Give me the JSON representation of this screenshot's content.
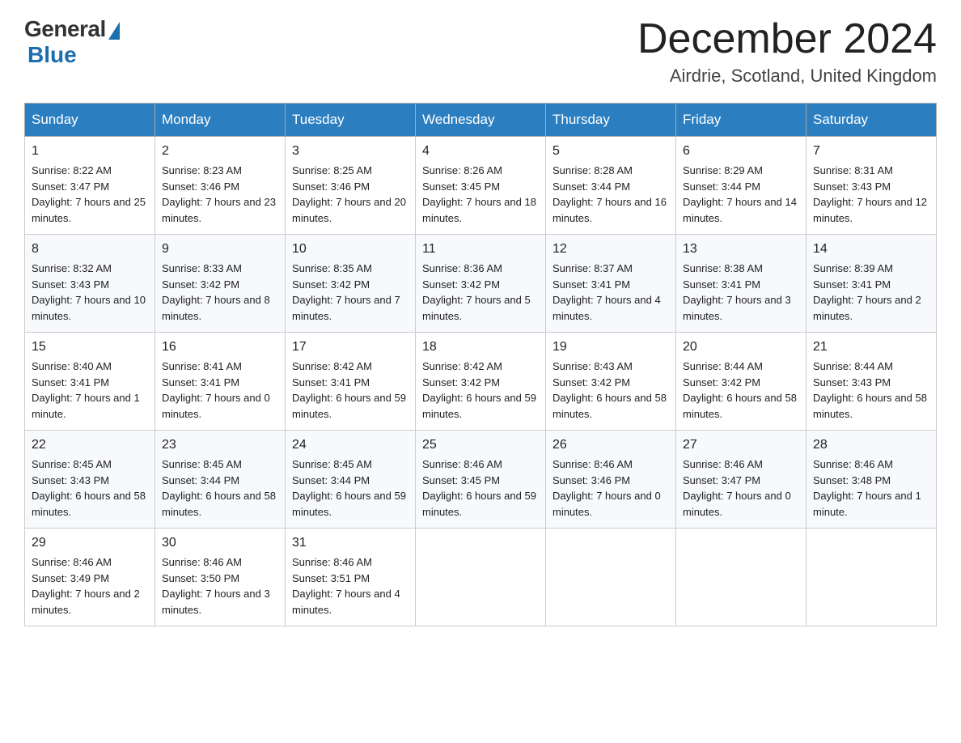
{
  "header": {
    "logo_general": "General",
    "logo_blue": "Blue",
    "month_title": "December 2024",
    "location": "Airdrie, Scotland, United Kingdom"
  },
  "days_of_week": [
    "Sunday",
    "Monday",
    "Tuesday",
    "Wednesday",
    "Thursday",
    "Friday",
    "Saturday"
  ],
  "weeks": [
    [
      {
        "day": "1",
        "sunrise": "Sunrise: 8:22 AM",
        "sunset": "Sunset: 3:47 PM",
        "daylight": "Daylight: 7 hours and 25 minutes."
      },
      {
        "day": "2",
        "sunrise": "Sunrise: 8:23 AM",
        "sunset": "Sunset: 3:46 PM",
        "daylight": "Daylight: 7 hours and 23 minutes."
      },
      {
        "day": "3",
        "sunrise": "Sunrise: 8:25 AM",
        "sunset": "Sunset: 3:46 PM",
        "daylight": "Daylight: 7 hours and 20 minutes."
      },
      {
        "day": "4",
        "sunrise": "Sunrise: 8:26 AM",
        "sunset": "Sunset: 3:45 PM",
        "daylight": "Daylight: 7 hours and 18 minutes."
      },
      {
        "day": "5",
        "sunrise": "Sunrise: 8:28 AM",
        "sunset": "Sunset: 3:44 PM",
        "daylight": "Daylight: 7 hours and 16 minutes."
      },
      {
        "day": "6",
        "sunrise": "Sunrise: 8:29 AM",
        "sunset": "Sunset: 3:44 PM",
        "daylight": "Daylight: 7 hours and 14 minutes."
      },
      {
        "day": "7",
        "sunrise": "Sunrise: 8:31 AM",
        "sunset": "Sunset: 3:43 PM",
        "daylight": "Daylight: 7 hours and 12 minutes."
      }
    ],
    [
      {
        "day": "8",
        "sunrise": "Sunrise: 8:32 AM",
        "sunset": "Sunset: 3:43 PM",
        "daylight": "Daylight: 7 hours and 10 minutes."
      },
      {
        "day": "9",
        "sunrise": "Sunrise: 8:33 AM",
        "sunset": "Sunset: 3:42 PM",
        "daylight": "Daylight: 7 hours and 8 minutes."
      },
      {
        "day": "10",
        "sunrise": "Sunrise: 8:35 AM",
        "sunset": "Sunset: 3:42 PM",
        "daylight": "Daylight: 7 hours and 7 minutes."
      },
      {
        "day": "11",
        "sunrise": "Sunrise: 8:36 AM",
        "sunset": "Sunset: 3:42 PM",
        "daylight": "Daylight: 7 hours and 5 minutes."
      },
      {
        "day": "12",
        "sunrise": "Sunrise: 8:37 AM",
        "sunset": "Sunset: 3:41 PM",
        "daylight": "Daylight: 7 hours and 4 minutes."
      },
      {
        "day": "13",
        "sunrise": "Sunrise: 8:38 AM",
        "sunset": "Sunset: 3:41 PM",
        "daylight": "Daylight: 7 hours and 3 minutes."
      },
      {
        "day": "14",
        "sunrise": "Sunrise: 8:39 AM",
        "sunset": "Sunset: 3:41 PM",
        "daylight": "Daylight: 7 hours and 2 minutes."
      }
    ],
    [
      {
        "day": "15",
        "sunrise": "Sunrise: 8:40 AM",
        "sunset": "Sunset: 3:41 PM",
        "daylight": "Daylight: 7 hours and 1 minute."
      },
      {
        "day": "16",
        "sunrise": "Sunrise: 8:41 AM",
        "sunset": "Sunset: 3:41 PM",
        "daylight": "Daylight: 7 hours and 0 minutes."
      },
      {
        "day": "17",
        "sunrise": "Sunrise: 8:42 AM",
        "sunset": "Sunset: 3:41 PM",
        "daylight": "Daylight: 6 hours and 59 minutes."
      },
      {
        "day": "18",
        "sunrise": "Sunrise: 8:42 AM",
        "sunset": "Sunset: 3:42 PM",
        "daylight": "Daylight: 6 hours and 59 minutes."
      },
      {
        "day": "19",
        "sunrise": "Sunrise: 8:43 AM",
        "sunset": "Sunset: 3:42 PM",
        "daylight": "Daylight: 6 hours and 58 minutes."
      },
      {
        "day": "20",
        "sunrise": "Sunrise: 8:44 AM",
        "sunset": "Sunset: 3:42 PM",
        "daylight": "Daylight: 6 hours and 58 minutes."
      },
      {
        "day": "21",
        "sunrise": "Sunrise: 8:44 AM",
        "sunset": "Sunset: 3:43 PM",
        "daylight": "Daylight: 6 hours and 58 minutes."
      }
    ],
    [
      {
        "day": "22",
        "sunrise": "Sunrise: 8:45 AM",
        "sunset": "Sunset: 3:43 PM",
        "daylight": "Daylight: 6 hours and 58 minutes."
      },
      {
        "day": "23",
        "sunrise": "Sunrise: 8:45 AM",
        "sunset": "Sunset: 3:44 PM",
        "daylight": "Daylight: 6 hours and 58 minutes."
      },
      {
        "day": "24",
        "sunrise": "Sunrise: 8:45 AM",
        "sunset": "Sunset: 3:44 PM",
        "daylight": "Daylight: 6 hours and 59 minutes."
      },
      {
        "day": "25",
        "sunrise": "Sunrise: 8:46 AM",
        "sunset": "Sunset: 3:45 PM",
        "daylight": "Daylight: 6 hours and 59 minutes."
      },
      {
        "day": "26",
        "sunrise": "Sunrise: 8:46 AM",
        "sunset": "Sunset: 3:46 PM",
        "daylight": "Daylight: 7 hours and 0 minutes."
      },
      {
        "day": "27",
        "sunrise": "Sunrise: 8:46 AM",
        "sunset": "Sunset: 3:47 PM",
        "daylight": "Daylight: 7 hours and 0 minutes."
      },
      {
        "day": "28",
        "sunrise": "Sunrise: 8:46 AM",
        "sunset": "Sunset: 3:48 PM",
        "daylight": "Daylight: 7 hours and 1 minute."
      }
    ],
    [
      {
        "day": "29",
        "sunrise": "Sunrise: 8:46 AM",
        "sunset": "Sunset: 3:49 PM",
        "daylight": "Daylight: 7 hours and 2 minutes."
      },
      {
        "day": "30",
        "sunrise": "Sunrise: 8:46 AM",
        "sunset": "Sunset: 3:50 PM",
        "daylight": "Daylight: 7 hours and 3 minutes."
      },
      {
        "day": "31",
        "sunrise": "Sunrise: 8:46 AM",
        "sunset": "Sunset: 3:51 PM",
        "daylight": "Daylight: 7 hours and 4 minutes."
      },
      null,
      null,
      null,
      null
    ]
  ]
}
